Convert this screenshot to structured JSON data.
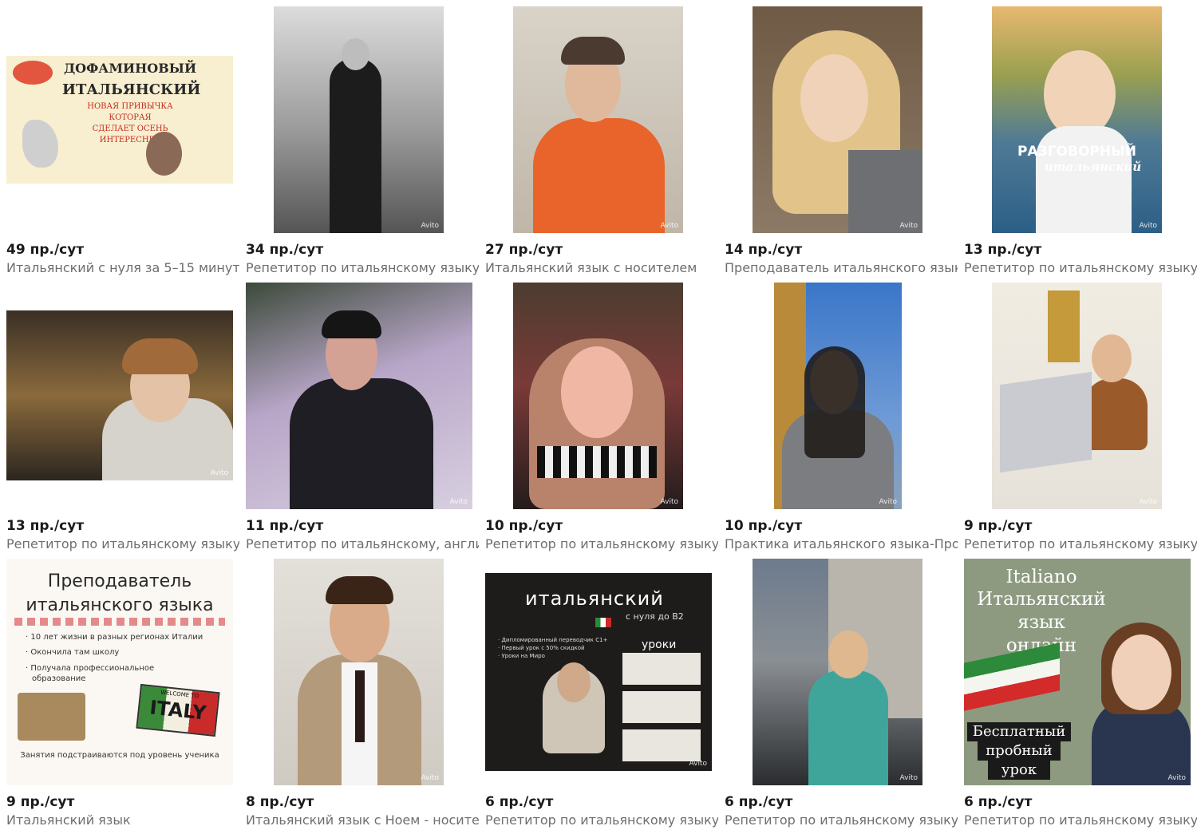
{
  "cards": [
    {
      "stat": "49 пр./сут",
      "title": "Итальянский с нуля за 5–15 минут",
      "overlay": [
        "ДОФАМИНОВЫЙ",
        "ИТАЛЬЯНСКИЙ",
        "НОВАЯ ПРИВЫЧКА",
        "КОТОРАЯ",
        "СДЕЛАЕТ ОСЕНЬ",
        "ИНТЕРЕСНЕЕ"
      ]
    },
    {
      "stat": "34 пр./сут",
      "title": "Репетитор по итальянскому языку",
      "wm": "Avito"
    },
    {
      "stat": "27 пр./сут",
      "title": "Итальянский язык с носителем",
      "wm": "Avito"
    },
    {
      "stat": "14 пр./сут",
      "title": "Преподаватель итальянского языка",
      "wm": "Avito"
    },
    {
      "stat": "13 пр./сут",
      "title": "Репетитор по итальянскому языку",
      "overlay": [
        "РАЗГОВОРНЫЙ",
        "итальянский"
      ],
      "wm": "Avito"
    },
    {
      "stat": "13 пр./сут",
      "title": "Репетитор по итальянскому языку",
      "wm": "Avito"
    },
    {
      "stat": "11 пр./сут",
      "title": "Репетитор по итальянскому, англи",
      "wm": "Avito"
    },
    {
      "stat": "10 пр./сут",
      "title": "Репетитор по итальянскому языку",
      "wm": "Avito"
    },
    {
      "stat": "10 пр./сут",
      "title": "Практика итальянского языка-Прог",
      "wm": "Avito"
    },
    {
      "stat": "9 пр./сут",
      "title": "Репетитор по итальянскому языку",
      "wm": "Avito"
    },
    {
      "stat": "9 пр./сут",
      "title": "Итальянский язык",
      "overlay": [
        "Преподаватель",
        "итальянского языка",
        "· 10 лет жизни в разных регионах Италии",
        "· Окончила там школу",
        "· Получала профессиональное",
        "образование",
        "WELCOME TO",
        "ITALY",
        "Занятия подстраиваются под уровень ученика"
      ]
    },
    {
      "stat": "8 пр./сут",
      "title": "Итальянский язык с Ноем - носите",
      "wm": "Avito"
    },
    {
      "stat": "6 пр./сут",
      "title": "Репетитор по итальянскому языку",
      "overlay": [
        "итальянский",
        "с нуля до В2",
        "· Дипломированный переводчик С1+",
        "· Первый урок с 50% скидкой",
        "· Уроки на Миро",
        "уроки"
      ],
      "wm": "Avito"
    },
    {
      "stat": "6 пр./сут",
      "title": "Репетитор по итальянскому языку",
      "wm": "Avito"
    },
    {
      "stat": "6 пр./сут",
      "title": "Репетитор по итальянскому языку",
      "overlay": [
        "Italiano",
        "Итальянский",
        "язык",
        "онлайн",
        "Бесплатный",
        "пробный",
        "урок"
      ],
      "wm": "Avito"
    }
  ],
  "colors": {
    "stat": "#1a1a1a",
    "title": "#6e6e6e"
  }
}
